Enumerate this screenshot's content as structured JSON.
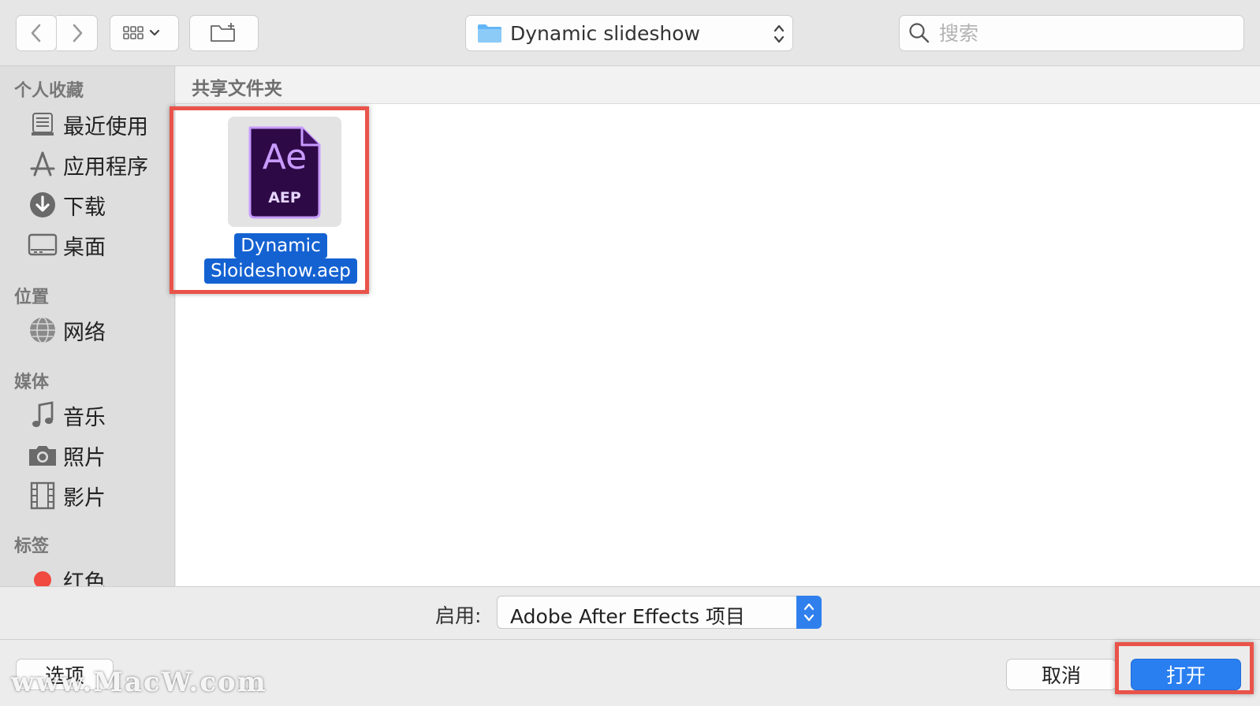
{
  "toolbar": {
    "back_icon": "chevron-left-icon",
    "forward_icon": "chevron-right-icon",
    "view_icon": "grid-view-icon",
    "new_folder_icon": "new-folder-icon",
    "path_folder": "Dynamic slideshow",
    "search_placeholder": "搜索"
  },
  "sidebar": {
    "sections": [
      {
        "title": "个人收藏",
        "items": [
          {
            "label": "最近使用",
            "icon": "recents-icon"
          },
          {
            "label": "应用程序",
            "icon": "applications-icon"
          },
          {
            "label": "下载",
            "icon": "downloads-icon"
          },
          {
            "label": "桌面",
            "icon": "desktop-icon"
          }
        ]
      },
      {
        "title": "位置",
        "items": [
          {
            "label": "网络",
            "icon": "network-icon"
          }
        ]
      },
      {
        "title": "媒体",
        "items": [
          {
            "label": "音乐",
            "icon": "music-icon"
          },
          {
            "label": "照片",
            "icon": "photos-icon"
          },
          {
            "label": "影片",
            "icon": "movies-icon"
          }
        ]
      },
      {
        "title": "标签",
        "items": [
          {
            "label": "红色",
            "icon": "red-tag-icon"
          }
        ]
      }
    ]
  },
  "content": {
    "header": "共享文件夹",
    "file": {
      "icon_text": "Ae",
      "icon_subtext": "AEP",
      "name_line1": "Dynamic",
      "name_line2": "Sloideshow.aep"
    }
  },
  "format": {
    "label": "启用:",
    "value": "Adobe After Effects 项目"
  },
  "buttons": {
    "options": "选项",
    "cancel": "取消",
    "open": "打开"
  },
  "watermark": "www.MacW.com",
  "colors": {
    "accent": "#2a7ff0",
    "selection": "#1462d2",
    "highlight_box": "#e9534a",
    "ae_purple": "#2d0a46",
    "ae_text": "#c89bff"
  }
}
